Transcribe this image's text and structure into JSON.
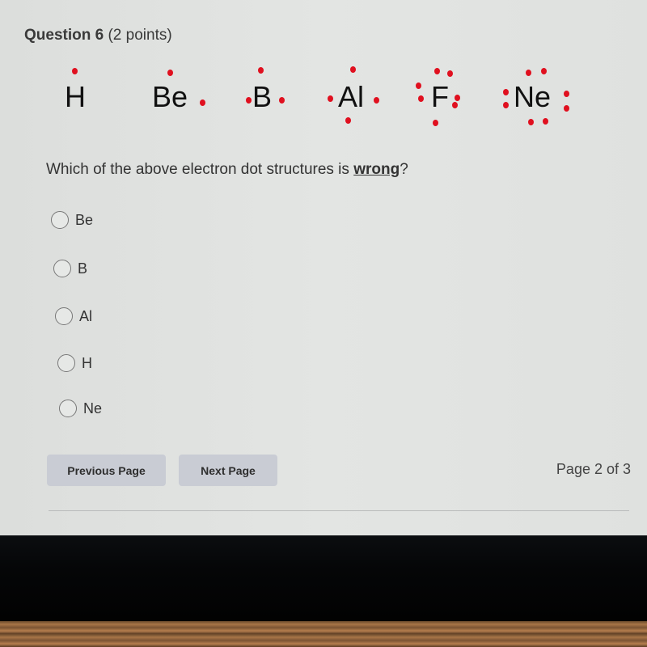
{
  "question": {
    "title": "Question 6",
    "points": "(2 points)",
    "prompt_before": "Which of the above electron dot structures is ",
    "prompt_emphasis": "wrong",
    "prompt_after": "?"
  },
  "structures": [
    {
      "symbol": "H",
      "electrons": 1
    },
    {
      "symbol": "Be",
      "electrons": 2
    },
    {
      "symbol": "B",
      "electrons": 3
    },
    {
      "symbol": "Al",
      "electrons": 4
    },
    {
      "symbol": "F",
      "electrons": 7
    },
    {
      "symbol": "Ne",
      "electrons": 8
    }
  ],
  "dot_color": "#e0101f",
  "options": [
    {
      "label": "Be",
      "selected": false
    },
    {
      "label": "B",
      "selected": false
    },
    {
      "label": "Al",
      "selected": false
    },
    {
      "label": "H",
      "selected": false
    },
    {
      "label": "Ne",
      "selected": false
    }
  ],
  "navigation": {
    "previous_label": "Previous Page",
    "next_label": "Next Page",
    "page_indicator": "Page 2 of 3"
  }
}
